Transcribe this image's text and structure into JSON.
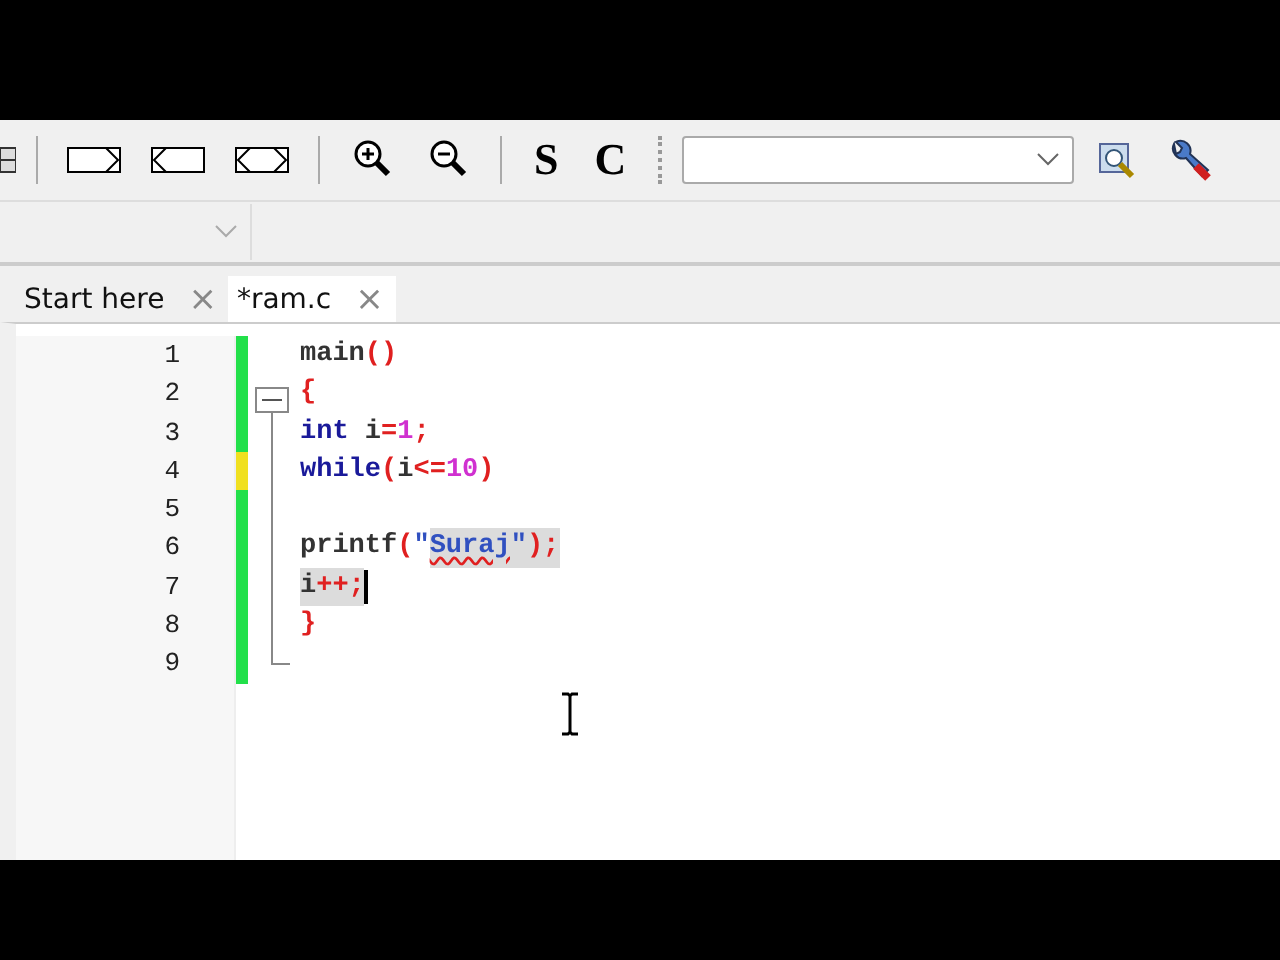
{
  "toolbar": {
    "glyph_buttons": [
      "S",
      "C"
    ]
  },
  "tabs": [
    {
      "label": "Start here",
      "close": "×",
      "selected": false
    },
    {
      "label": "*ram.c",
      "close": "×",
      "selected": true
    }
  ],
  "editor": {
    "folding": {
      "expanded": true
    },
    "lines": [
      {
        "number": "1",
        "color": "#22e04a",
        "caret": false,
        "tokens": [
          {
            "kind": "plain",
            "text": "main",
            "selected": false
          },
          {
            "kind": "op",
            "text": "()",
            "selected": false
          }
        ]
      },
      {
        "number": "2",
        "color": "#22e04a",
        "caret": false,
        "tokens": [
          {
            "kind": "op",
            "text": "{",
            "selected": false
          }
        ]
      },
      {
        "number": "3",
        "color": "#22e04a",
        "caret": false,
        "tokens": [
          {
            "kind": "keyword",
            "text": "int",
            "selected": false
          },
          {
            "kind": "plain",
            "text": " i",
            "selected": false
          },
          {
            "kind": "op",
            "text": "=",
            "selected": false
          },
          {
            "kind": "number",
            "text": "1",
            "selected": false
          },
          {
            "kind": "op",
            "text": ";",
            "selected": false
          }
        ]
      },
      {
        "number": "4",
        "color": "#f0e020",
        "caret": false,
        "tokens": [
          {
            "kind": "keyword",
            "text": "while",
            "selected": false
          },
          {
            "kind": "op",
            "text": "(",
            "selected": false
          },
          {
            "kind": "plain",
            "text": "i",
            "selected": false
          },
          {
            "kind": "op",
            "text": "<=",
            "selected": false
          },
          {
            "kind": "number",
            "text": "10",
            "selected": false
          },
          {
            "kind": "op",
            "text": ")",
            "selected": false
          }
        ]
      },
      {
        "number": "5",
        "color": "#22e04a",
        "caret": false
      },
      {
        "number": "6",
        "color": "#22e04a",
        "caret": false,
        "tokens": [
          {
            "kind": "plain",
            "text": "printf",
            "selected": false
          },
          {
            "kind": "op",
            "text": "(",
            "selected": false
          },
          {
            "kind": "string",
            "text": "\"",
            "selected": false
          },
          {
            "kind": "string",
            "text": "Suraj",
            "selected": true,
            "misspelled": true
          },
          {
            "kind": "string",
            "text": "\"",
            "selected": true
          },
          {
            "kind": "op",
            "text": ");",
            "selected": true
          }
        ]
      },
      {
        "number": "7",
        "color": "#22e04a",
        "caret": true,
        "tokens": [
          {
            "kind": "plain",
            "text": "i",
            "selected": true
          },
          {
            "kind": "op",
            "text": "++;",
            "selected": true
          }
        ]
      },
      {
        "number": "8",
        "color": "#22e04a",
        "caret": false,
        "tokens": [
          {
            "kind": "op",
            "text": "}",
            "selected": false
          }
        ]
      },
      {
        "number": "9",
        "color": "#22e04a",
        "caret": false
      }
    ]
  }
}
